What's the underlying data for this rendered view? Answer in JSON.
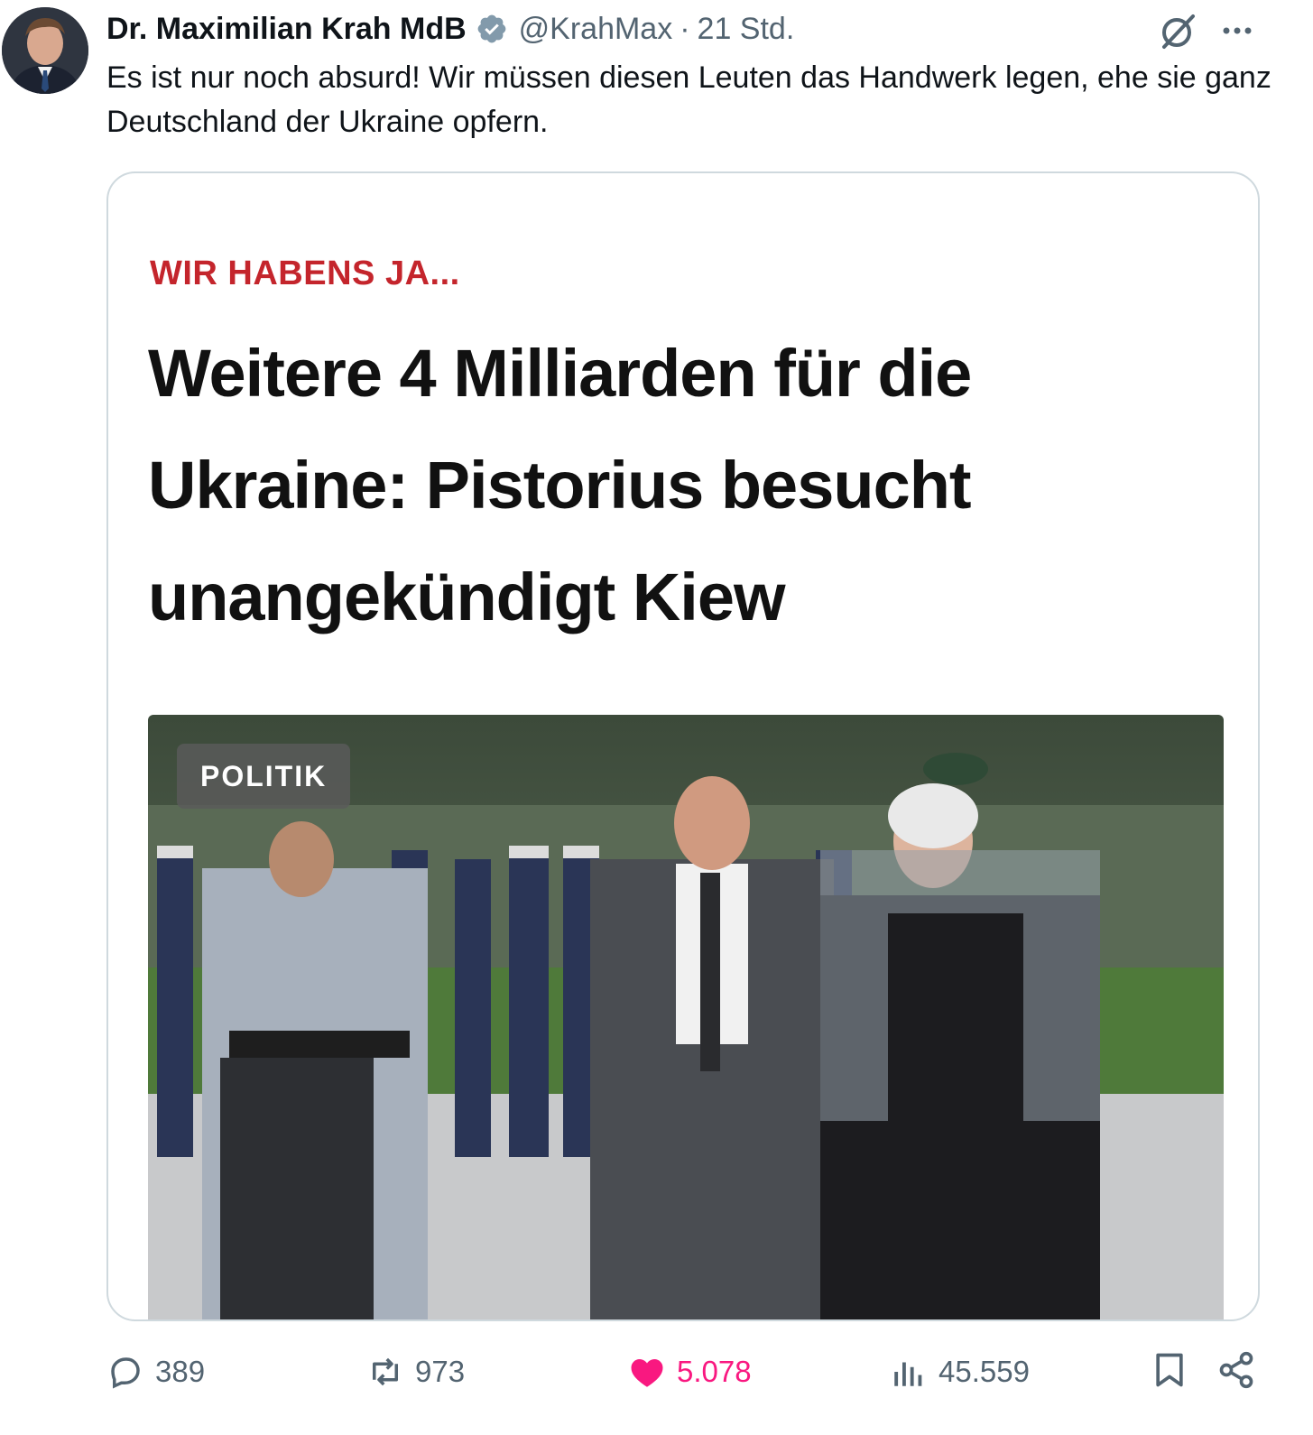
{
  "author": {
    "name": "Dr. Maximilian Krah MdB",
    "handle": "@KrahMax",
    "separator": "·",
    "time": "21 Std."
  },
  "tweet": {
    "text": "Es ist nur noch absurd! Wir müssen diesen Leuten das Handwerk legen, ehe sie ganz Deutschland der Ukraine opfern."
  },
  "card": {
    "kicker": "WIR HABENS JA...",
    "headline": "Weitere 4 Milliarden für die Ukraine: Pistorius besucht unangekündigt Kiew",
    "tag": "POLITIK"
  },
  "actions": {
    "replies": "389",
    "reposts": "973",
    "likes": "5.078",
    "views": "45.559"
  },
  "icons": {
    "verified": "verified-badge-icon",
    "grok": "grok-icon",
    "more": "more-icon",
    "reply": "reply-icon",
    "repost": "repost-icon",
    "like": "heart-icon",
    "views": "views-icon",
    "bookmark": "bookmark-icon",
    "share": "share-icon"
  },
  "colors": {
    "accent_like": "#f91880",
    "verified": "#829aab",
    "kicker": "#c4252c",
    "secondary_text": "#536471"
  }
}
